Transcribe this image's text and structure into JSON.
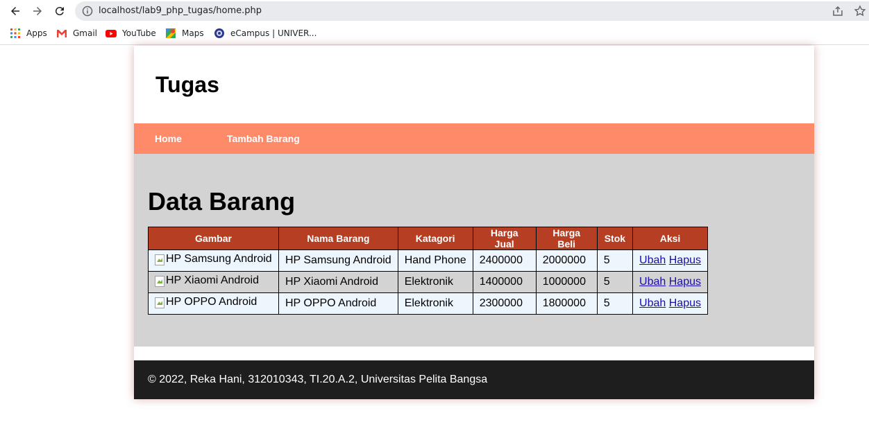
{
  "browser": {
    "url": "localhost/lab9_php_tugas/home.php",
    "bookmarks": [
      {
        "label": "Apps",
        "icon": "apps-grid-icon"
      },
      {
        "label": "Gmail",
        "icon": "gmail-icon"
      },
      {
        "label": "YouTube",
        "icon": "youtube-icon"
      },
      {
        "label": "Maps",
        "icon": "maps-icon"
      },
      {
        "label": "eCampus | UNIVER...",
        "icon": "ecampus-icon"
      }
    ]
  },
  "site": {
    "title": "Tugas",
    "nav": [
      {
        "label": "Home"
      },
      {
        "label": "Tambah Barang"
      }
    ]
  },
  "main": {
    "heading": "Data Barang",
    "columns": [
      "Gambar",
      "Nama Barang",
      "Katagori",
      "Harga Jual",
      "Harga Beli",
      "Stok",
      "Aksi"
    ],
    "rows": [
      {
        "gambar_alt": "HP Samsung Android",
        "nama": "HP Samsung Android",
        "kategori": "Hand Phone",
        "harga_jual": "2400000",
        "harga_beli": "2000000",
        "stok": "5",
        "ubah": "Ubah",
        "hapus": "Hapus"
      },
      {
        "gambar_alt": "HP Xiaomi Android",
        "nama": "HP Xiaomi Android",
        "kategori": "Elektronik",
        "harga_jual": "1400000",
        "harga_beli": "1000000",
        "stok": "5",
        "ubah": "Ubah",
        "hapus": "Hapus"
      },
      {
        "gambar_alt": "HP OPPO Android",
        "nama": "HP OPPO Android",
        "kategori": "Elektronik",
        "harga_jual": "2300000",
        "harga_beli": "1800000",
        "stok": "5",
        "ubah": "Ubah",
        "hapus": "Hapus"
      }
    ]
  },
  "footer": {
    "text": "© 2022, Reka Hani, 312010343, TI.20.A.2, Universitas Pelita Bangsa"
  },
  "colors": {
    "nav_bg": "#ff8a6a",
    "table_header_bg": "#b63f23",
    "main_bg": "#d3d3d3",
    "footer_bg": "#1e1e1e"
  }
}
